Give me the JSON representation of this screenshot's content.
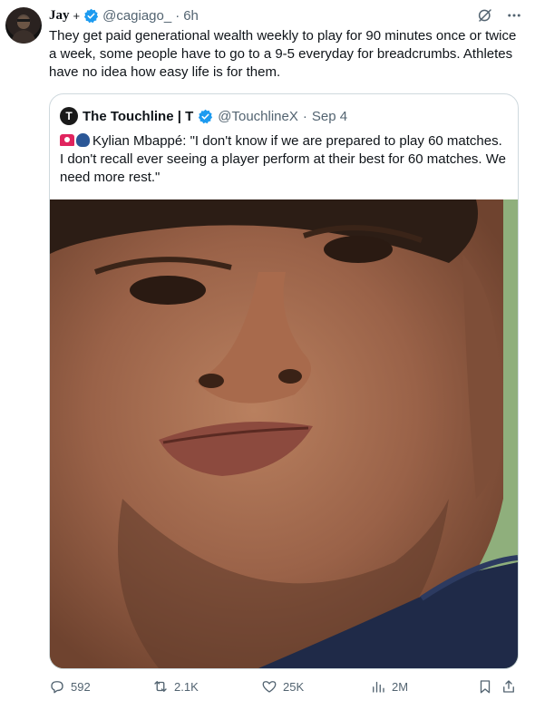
{
  "tweet": {
    "author_name": "Jay",
    "plus": "+",
    "handle": "@cagiago_",
    "sep": "·",
    "time": "6h",
    "text": "They get paid generational wealth weekly to play for 90 minutes once or twice a week, some people have to go to a 9-5 everyday for breadcrumbs. Athletes have no idea how easy life is for them."
  },
  "quote": {
    "avatar_letter": "T",
    "author_name": "The Touchline | T",
    "handle": "@TouchlineX",
    "sep": "·",
    "date": "Sep 4",
    "text": "Kylian Mbappé: \"I don't know if we are prepared to play 60 matches. I don't recall ever seeing a player perform at their best for 60 matches. We need more rest.\""
  },
  "actions": {
    "replies": "592",
    "reposts": "2.1K",
    "likes": "25K",
    "views": "2M"
  },
  "colors": {
    "verified": "#1d9bf0",
    "muted": "#536471",
    "border": "#cfd9de"
  }
}
